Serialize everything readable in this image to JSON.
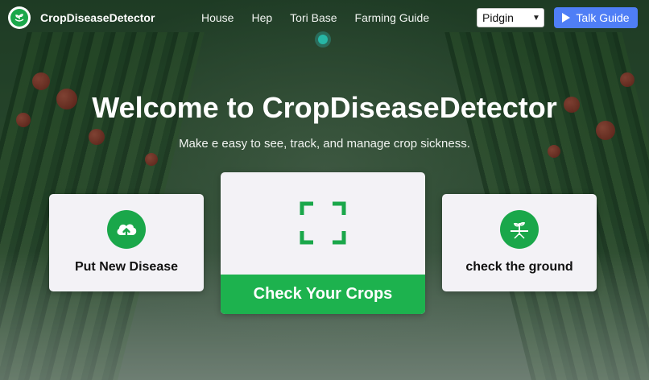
{
  "brand": {
    "name": "CropDiseaseDetector",
    "logo_icon": "sprout-hands-icon"
  },
  "nav": {
    "links": [
      "House",
      "Hep",
      "Tori Base",
      "Farming Guide"
    ]
  },
  "language_select": {
    "selected": "Pidgin"
  },
  "talk_button": {
    "label": "Talk Guide",
    "icon": "play-icon"
  },
  "hero": {
    "title": "Welcome to CropDiseaseDetector",
    "subtitle": "Make e easy to see, track, and manage crop sickness."
  },
  "cards": {
    "left": {
      "label": "Put New Disease",
      "icon": "cloud-upload-icon"
    },
    "center": {
      "button_label": "Check Your Crops",
      "icon": "scan-frame-icon"
    },
    "right": {
      "label": "check the ground",
      "icon": "soil-plant-icon"
    }
  },
  "colors": {
    "accent_green": "#1db24e",
    "icon_green": "#1aa74a",
    "talk_blue": "#4f7ef6",
    "card_bg": "#f3f2f6"
  }
}
